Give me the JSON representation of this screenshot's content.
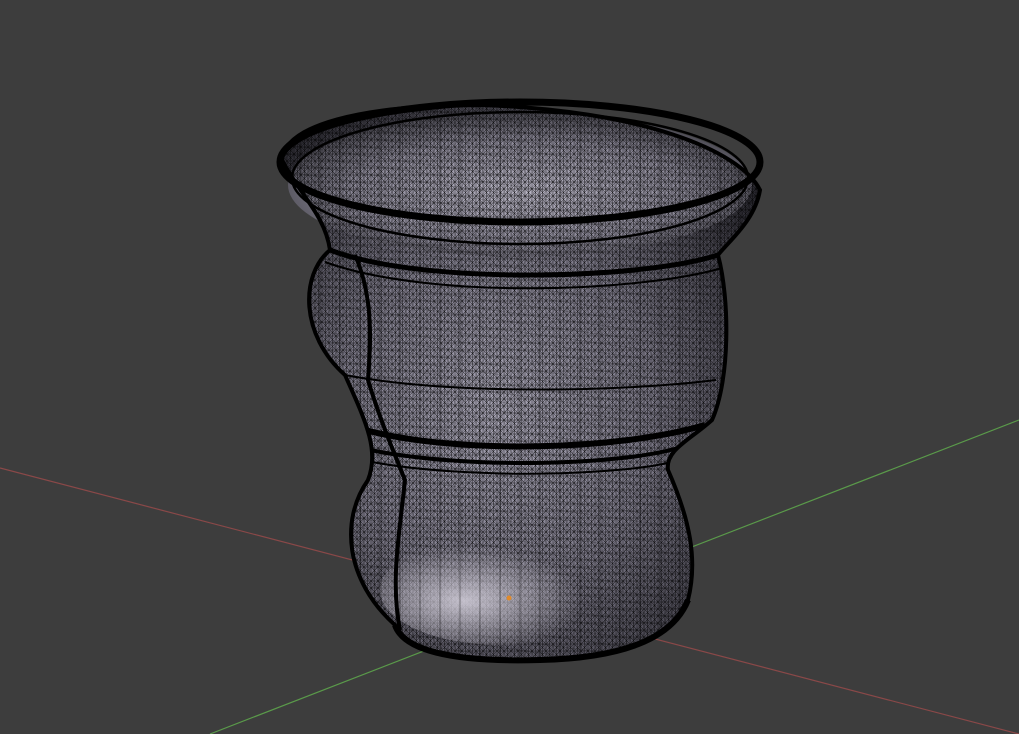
{
  "viewport": {
    "background_color": "#3d3d3d",
    "display_mode": "wireframe",
    "object_shape": "vase"
  },
  "axes": {
    "x_axis_color": "#8a4848",
    "y_axis_color": "#5a9a4a"
  },
  "object": {
    "wire_color": "#000000",
    "surface_color": "#6e6c78",
    "highlight_color": "#c8c6d2",
    "origin_color": "#e08a2a"
  }
}
